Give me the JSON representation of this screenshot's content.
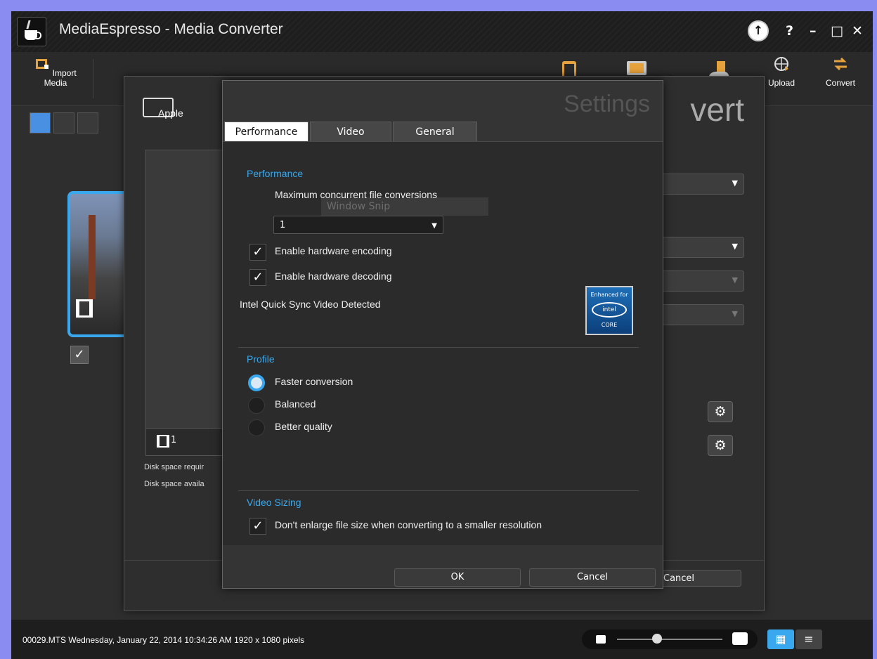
{
  "window": {
    "title": "MediaEspresso - Media Converter",
    "controls": [
      "?",
      "–",
      "□",
      "✕"
    ]
  },
  "toolbar": {
    "import_label": "Import Media",
    "upload_label": "Upload",
    "convert_label": "Convert"
  },
  "convert_dialog": {
    "header_word": "vert",
    "device_label": "Apple",
    "file_count": "1",
    "disk_required": "Disk space requir",
    "disk_available": "Disk space availa",
    "cancel_label": "Cancel"
  },
  "settings": {
    "header_word": "Settings",
    "tabs": [
      {
        "label": "Performance",
        "active": true
      },
      {
        "label": "Video",
        "active": false
      },
      {
        "label": "General",
        "active": false
      }
    ],
    "ghost_text": "Window Snip",
    "performance": {
      "section_title": "Performance",
      "max_label": "Maximum concurrent file conversions",
      "max_value": "1",
      "hw_encoding_label": "Enable hardware encoding",
      "hw_encoding_checked": true,
      "hw_decoding_label": "Enable hardware decoding",
      "hw_decoding_checked": true,
      "detected_label": "Intel Quick Sync Video Detected",
      "badge_top": "Enhanced for",
      "badge_brand": "intel",
      "badge_bottom": "CORE"
    },
    "profile": {
      "section_title": "Profile",
      "options": [
        {
          "label": "Faster conversion",
          "selected": true
        },
        {
          "label": "Balanced",
          "selected": false
        },
        {
          "label": "Better quality",
          "selected": false
        }
      ]
    },
    "video_sizing": {
      "section_title": "Video Sizing",
      "no_enlarge_label": "Don't enlarge file size when converting to a smaller resolution",
      "no_enlarge_checked": true
    },
    "ok_label": "OK",
    "cancel_label": "Cancel"
  },
  "statusbar": {
    "text": "00029.MTS  Wednesday, January 22, 2014 10:34:26 AM  1920 x 1080 pixels",
    "zoom_percent": 50
  },
  "colors": {
    "accent": "#3aa8ee",
    "background": "#2e2e2e",
    "highlight_tool": "#e6a23c"
  }
}
